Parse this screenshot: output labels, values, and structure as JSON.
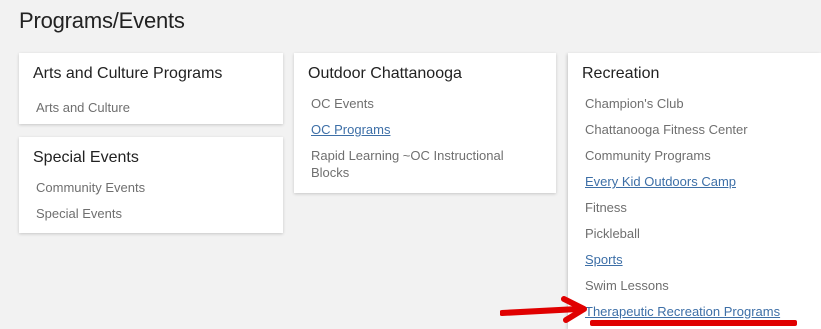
{
  "page": {
    "title": "Programs/Events"
  },
  "cards": {
    "arts": {
      "title": "Arts and Culture Programs",
      "items": [
        "Arts and Culture"
      ]
    },
    "special": {
      "title": "Special Events",
      "items": [
        "Community Events",
        "Special Events"
      ]
    },
    "outdoor": {
      "title": "Outdoor Chattanooga",
      "items": [
        "OC Events",
        "OC Programs",
        "Rapid Learning ~OC Instructional Blocks"
      ]
    },
    "recreation": {
      "title": "Recreation",
      "items": [
        "Champion's Club",
        "Chattanooga Fitness Center",
        "Community Programs",
        "Every Kid Outdoors Camp",
        "Fitness",
        "Pickleball",
        "Sports",
        "Swim Lessons",
        "Therapeutic Recreation Programs"
      ]
    }
  },
  "colors": {
    "link": "#3d6fa7",
    "annotation": "#e00000",
    "muted_text": "#6f6f6f"
  },
  "annotation": {
    "arrow_icon": "right-arrow-icon",
    "highlight": "red-underline"
  }
}
